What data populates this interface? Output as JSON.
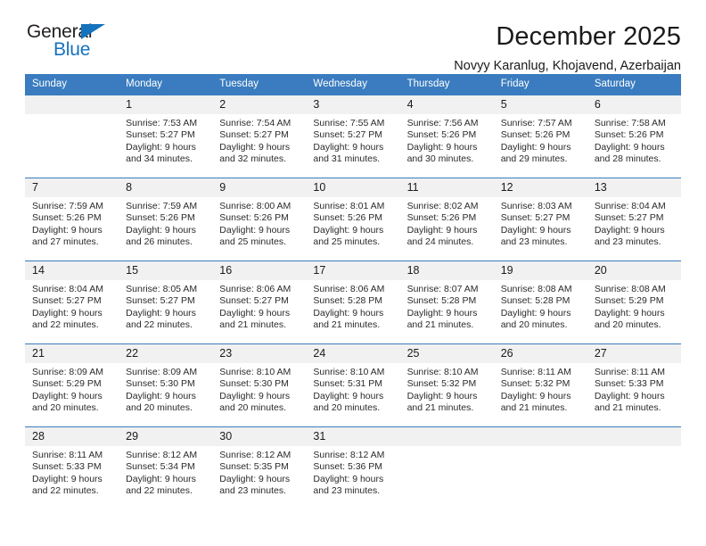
{
  "brand": {
    "name_part1": "General",
    "name_part2": "Blue",
    "accent_color": "#1572bd"
  },
  "header": {
    "title": "December 2025",
    "subtitle": "Novyy Karanlug, Khojavend, Azerbaijan",
    "header_bg_color": "#3a7cbf",
    "daynum_bg_color": "#f1f1f1"
  },
  "weekday_headers": [
    "Sunday",
    "Monday",
    "Tuesday",
    "Wednesday",
    "Thursday",
    "Friday",
    "Saturday"
  ],
  "weeks": [
    {
      "days": [
        {
          "num": "",
          "sunrise": "",
          "sunset": "",
          "daylight1": "",
          "daylight2": ""
        },
        {
          "num": "1",
          "sunrise": "Sunrise: 7:53 AM",
          "sunset": "Sunset: 5:27 PM",
          "daylight1": "Daylight: 9 hours",
          "daylight2": "and 34 minutes."
        },
        {
          "num": "2",
          "sunrise": "Sunrise: 7:54 AM",
          "sunset": "Sunset: 5:27 PM",
          "daylight1": "Daylight: 9 hours",
          "daylight2": "and 32 minutes."
        },
        {
          "num": "3",
          "sunrise": "Sunrise: 7:55 AM",
          "sunset": "Sunset: 5:27 PM",
          "daylight1": "Daylight: 9 hours",
          "daylight2": "and 31 minutes."
        },
        {
          "num": "4",
          "sunrise": "Sunrise: 7:56 AM",
          "sunset": "Sunset: 5:26 PM",
          "daylight1": "Daylight: 9 hours",
          "daylight2": "and 30 minutes."
        },
        {
          "num": "5",
          "sunrise": "Sunrise: 7:57 AM",
          "sunset": "Sunset: 5:26 PM",
          "daylight1": "Daylight: 9 hours",
          "daylight2": "and 29 minutes."
        },
        {
          "num": "6",
          "sunrise": "Sunrise: 7:58 AM",
          "sunset": "Sunset: 5:26 PM",
          "daylight1": "Daylight: 9 hours",
          "daylight2": "and 28 minutes."
        }
      ]
    },
    {
      "days": [
        {
          "num": "7",
          "sunrise": "Sunrise: 7:59 AM",
          "sunset": "Sunset: 5:26 PM",
          "daylight1": "Daylight: 9 hours",
          "daylight2": "and 27 minutes."
        },
        {
          "num": "8",
          "sunrise": "Sunrise: 7:59 AM",
          "sunset": "Sunset: 5:26 PM",
          "daylight1": "Daylight: 9 hours",
          "daylight2": "and 26 minutes."
        },
        {
          "num": "9",
          "sunrise": "Sunrise: 8:00 AM",
          "sunset": "Sunset: 5:26 PM",
          "daylight1": "Daylight: 9 hours",
          "daylight2": "and 25 minutes."
        },
        {
          "num": "10",
          "sunrise": "Sunrise: 8:01 AM",
          "sunset": "Sunset: 5:26 PM",
          "daylight1": "Daylight: 9 hours",
          "daylight2": "and 25 minutes."
        },
        {
          "num": "11",
          "sunrise": "Sunrise: 8:02 AM",
          "sunset": "Sunset: 5:26 PM",
          "daylight1": "Daylight: 9 hours",
          "daylight2": "and 24 minutes."
        },
        {
          "num": "12",
          "sunrise": "Sunrise: 8:03 AM",
          "sunset": "Sunset: 5:27 PM",
          "daylight1": "Daylight: 9 hours",
          "daylight2": "and 23 minutes."
        },
        {
          "num": "13",
          "sunrise": "Sunrise: 8:04 AM",
          "sunset": "Sunset: 5:27 PM",
          "daylight1": "Daylight: 9 hours",
          "daylight2": "and 23 minutes."
        }
      ]
    },
    {
      "days": [
        {
          "num": "14",
          "sunrise": "Sunrise: 8:04 AM",
          "sunset": "Sunset: 5:27 PM",
          "daylight1": "Daylight: 9 hours",
          "daylight2": "and 22 minutes."
        },
        {
          "num": "15",
          "sunrise": "Sunrise: 8:05 AM",
          "sunset": "Sunset: 5:27 PM",
          "daylight1": "Daylight: 9 hours",
          "daylight2": "and 22 minutes."
        },
        {
          "num": "16",
          "sunrise": "Sunrise: 8:06 AM",
          "sunset": "Sunset: 5:27 PM",
          "daylight1": "Daylight: 9 hours",
          "daylight2": "and 21 minutes."
        },
        {
          "num": "17",
          "sunrise": "Sunrise: 8:06 AM",
          "sunset": "Sunset: 5:28 PM",
          "daylight1": "Daylight: 9 hours",
          "daylight2": "and 21 minutes."
        },
        {
          "num": "18",
          "sunrise": "Sunrise: 8:07 AM",
          "sunset": "Sunset: 5:28 PM",
          "daylight1": "Daylight: 9 hours",
          "daylight2": "and 21 minutes."
        },
        {
          "num": "19",
          "sunrise": "Sunrise: 8:08 AM",
          "sunset": "Sunset: 5:28 PM",
          "daylight1": "Daylight: 9 hours",
          "daylight2": "and 20 minutes."
        },
        {
          "num": "20",
          "sunrise": "Sunrise: 8:08 AM",
          "sunset": "Sunset: 5:29 PM",
          "daylight1": "Daylight: 9 hours",
          "daylight2": "and 20 minutes."
        }
      ]
    },
    {
      "days": [
        {
          "num": "21",
          "sunrise": "Sunrise: 8:09 AM",
          "sunset": "Sunset: 5:29 PM",
          "daylight1": "Daylight: 9 hours",
          "daylight2": "and 20 minutes."
        },
        {
          "num": "22",
          "sunrise": "Sunrise: 8:09 AM",
          "sunset": "Sunset: 5:30 PM",
          "daylight1": "Daylight: 9 hours",
          "daylight2": "and 20 minutes."
        },
        {
          "num": "23",
          "sunrise": "Sunrise: 8:10 AM",
          "sunset": "Sunset: 5:30 PM",
          "daylight1": "Daylight: 9 hours",
          "daylight2": "and 20 minutes."
        },
        {
          "num": "24",
          "sunrise": "Sunrise: 8:10 AM",
          "sunset": "Sunset: 5:31 PM",
          "daylight1": "Daylight: 9 hours",
          "daylight2": "and 20 minutes."
        },
        {
          "num": "25",
          "sunrise": "Sunrise: 8:10 AM",
          "sunset": "Sunset: 5:32 PM",
          "daylight1": "Daylight: 9 hours",
          "daylight2": "and 21 minutes."
        },
        {
          "num": "26",
          "sunrise": "Sunrise: 8:11 AM",
          "sunset": "Sunset: 5:32 PM",
          "daylight1": "Daylight: 9 hours",
          "daylight2": "and 21 minutes."
        },
        {
          "num": "27",
          "sunrise": "Sunrise: 8:11 AM",
          "sunset": "Sunset: 5:33 PM",
          "daylight1": "Daylight: 9 hours",
          "daylight2": "and 21 minutes."
        }
      ]
    },
    {
      "days": [
        {
          "num": "28",
          "sunrise": "Sunrise: 8:11 AM",
          "sunset": "Sunset: 5:33 PM",
          "daylight1": "Daylight: 9 hours",
          "daylight2": "and 22 minutes."
        },
        {
          "num": "29",
          "sunrise": "Sunrise: 8:12 AM",
          "sunset": "Sunset: 5:34 PM",
          "daylight1": "Daylight: 9 hours",
          "daylight2": "and 22 minutes."
        },
        {
          "num": "30",
          "sunrise": "Sunrise: 8:12 AM",
          "sunset": "Sunset: 5:35 PM",
          "daylight1": "Daylight: 9 hours",
          "daylight2": "and 23 minutes."
        },
        {
          "num": "31",
          "sunrise": "Sunrise: 8:12 AM",
          "sunset": "Sunset: 5:36 PM",
          "daylight1": "Daylight: 9 hours",
          "daylight2": "and 23 minutes."
        },
        {
          "num": "",
          "sunrise": "",
          "sunset": "",
          "daylight1": "",
          "daylight2": ""
        },
        {
          "num": "",
          "sunrise": "",
          "sunset": "",
          "daylight1": "",
          "daylight2": ""
        },
        {
          "num": "",
          "sunrise": "",
          "sunset": "",
          "daylight1": "",
          "daylight2": ""
        }
      ]
    }
  ]
}
